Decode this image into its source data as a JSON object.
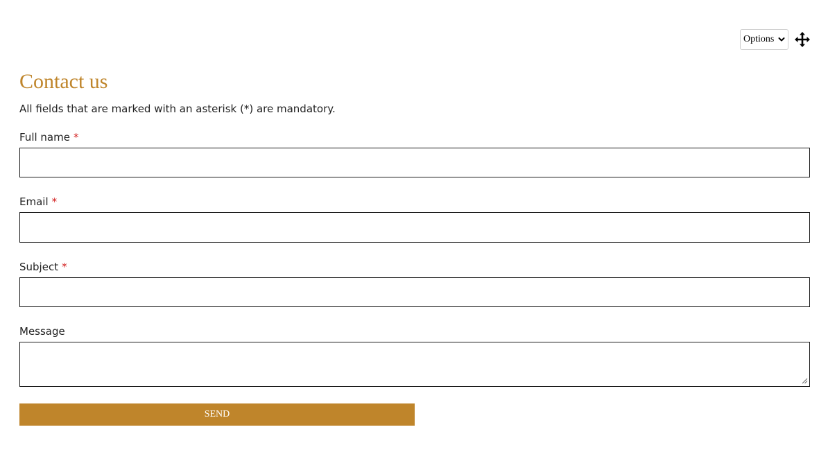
{
  "toolbar": {
    "options_label": "Options",
    "chevron_icon": "chevron-down-icon",
    "move_icon": "move-arrows-icon"
  },
  "form": {
    "title": "Contact us",
    "intro": "All fields that are marked with an asterisk (*) are mandatory.",
    "required_marker": "*",
    "fields": [
      {
        "label": "Full name",
        "required": true,
        "value": "",
        "type": "text"
      },
      {
        "label": "Email",
        "required": true,
        "value": "",
        "type": "text"
      },
      {
        "label": "Subject",
        "required": true,
        "value": "",
        "type": "text"
      },
      {
        "label": "Message",
        "required": false,
        "value": "",
        "type": "textarea"
      }
    ],
    "send_label": "SEND"
  },
  "colors": {
    "accent": "#bf852b",
    "required": "#d21f1f",
    "text": "#222222",
    "border": "#1a1a1a"
  }
}
